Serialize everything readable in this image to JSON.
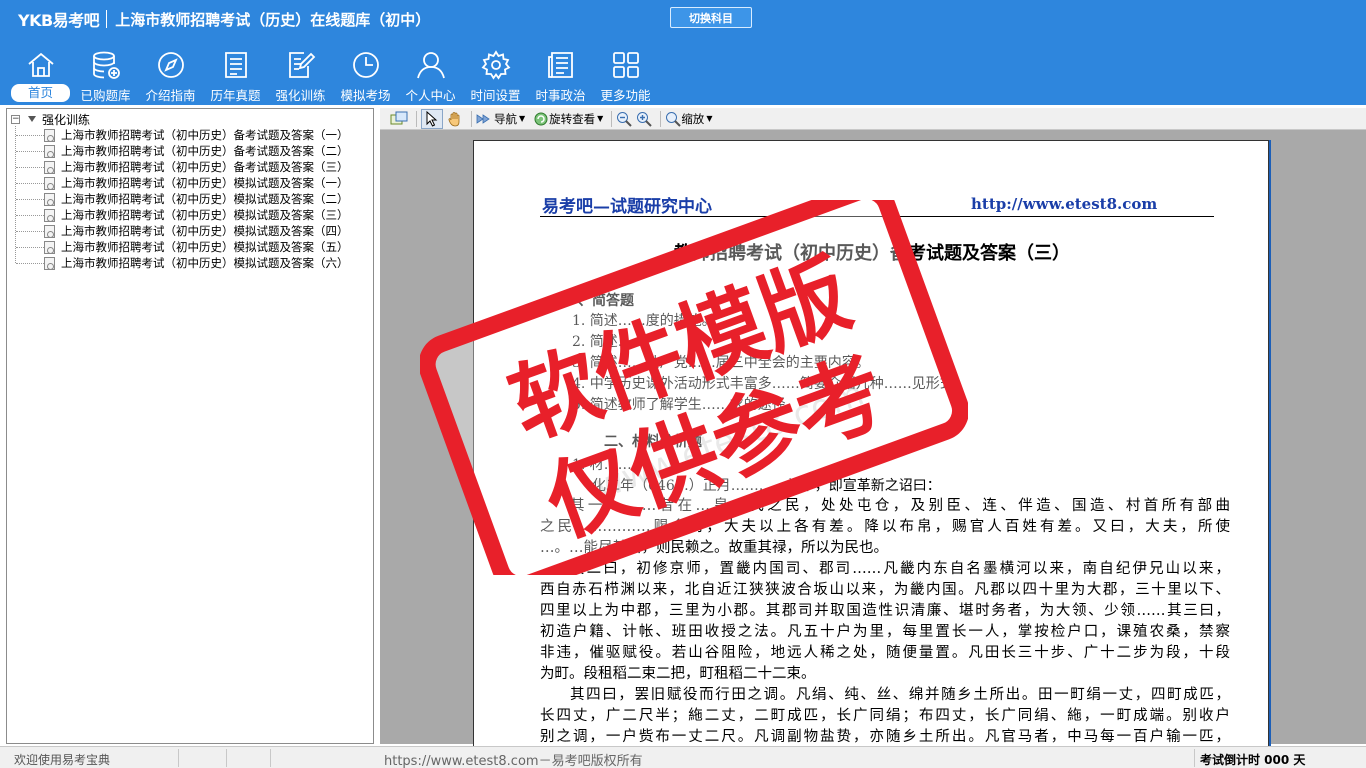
{
  "app": {
    "logo": "YKB易考吧",
    "title": "上海市教师招聘考试（历史）在线题库（初中）",
    "switch_label": "切换科目"
  },
  "nav": [
    {
      "label": "首页",
      "icon": "home-icon"
    },
    {
      "label": "已购题库",
      "icon": "database-icon"
    },
    {
      "label": "介绍指南",
      "icon": "compass-icon"
    },
    {
      "label": "历年真题",
      "icon": "document-list-icon"
    },
    {
      "label": "强化训练",
      "icon": "edit-document-icon"
    },
    {
      "label": "模拟考场",
      "icon": "clock-icon"
    },
    {
      "label": "个人中心",
      "icon": "user-icon"
    },
    {
      "label": "时间设置",
      "icon": "gear-icon"
    },
    {
      "label": "时事政治",
      "icon": "newspaper-icon"
    },
    {
      "label": "更多功能",
      "icon": "grid-icon"
    }
  ],
  "tree": {
    "root": "强化训练",
    "items": [
      "上海市教师招聘考试（初中历史）备考试题及答案（一）",
      "上海市教师招聘考试（初中历史）备考试题及答案（二）",
      "上海市教师招聘考试（初中历史）备考试题及答案（三）",
      "上海市教师招聘考试（初中历史）模拟试题及答案（一）",
      "上海市教师招聘考试（初中历史）模拟试题及答案（二）",
      "上海市教师招聘考试（初中历史）模拟试题及答案（三）",
      "上海市教师招聘考试（初中历史）模拟试题及答案（四）",
      "上海市教师招聘考试（初中历史）模拟试题及答案（五）",
      "上海市教师招聘考试（初中历史）模拟试题及答案（六）"
    ]
  },
  "viewer_toolbar": {
    "nav_label": "导航",
    "rotate_label": "旋转查看",
    "zoom_label": "缩放"
  },
  "document": {
    "header_left": "易考吧—试题研究中心",
    "header_right": "http://www.etest8.com",
    "title": "教师招聘考试（初中历史）备考试题及答案（三）",
    "section1": "一、简答题",
    "q1": "1. 简述……度的措施。",
    "q2": "2. 简述……",
    "q3": "3. 简述……共产党……届三中全会的主要内容。",
    "q4": "4. 中学历史课外活动形式丰富多……简要介绍几种……见形式。",
    "q5": "5. 简述教师了解学生……求的途径。",
    "section2": "二、材料分析题",
    "m1": "1. 材……",
    "p1": "化二年（646…）正月…………礼毕，即宣革新之诏曰：",
    "lines": [
      "其一…，…昔在…皇…代之民，处处屯仓，及别臣、连、伴造、国造、村首所有部曲",
      "之民，…………赐食封，大夫以上各有差。降以布帛，赐官人百姓有差。又曰，大夫，所使",
      "…。…能尽其治，则民赖之。故重其禄，所以为民也。",
      "其二曰，初修京师，置畿内国司、郡司……凡畿内东自名墨横河以来，南自纪伊兄山以来，",
      "西自赤石栉渊以来，北自近江狭狭波合坂山以来，为畿内国。凡郡以四十里为大郡，三十里以下、",
      "四里以上为中郡，三里为小郡。其郡司并取国造性识清廉、堪时务者，为大领、少领……其三曰，",
      "初造户籍、计帐、班田收授之法。凡五十户为里，每里置长一人，掌按检户口，课殖农桑，禁察",
      "非违，催驱赋役。若山谷阻险，地远人稀之处，随便量置。凡田长三十步、广十二步为段，十段",
      "为町。段租稻二束二把，町租稻二十二束。",
      "其四曰，罢旧赋役而行田之调。凡绢、纯、丝、绵并随乡土所出。田一町绢一丈，四町成匹，",
      "长四丈，广二尺半；絁二丈，二町成匹，长广同绢；布四丈，长广同绢、絁，一町成端。别收户",
      "别之调，一户赀布一丈二尺。凡调副物盐贽，亦随乡土所出。凡官马者，中马每一百户输一匹，"
    ]
  },
  "stamp": {
    "line1": "软件模版",
    "line2": "仅供参考",
    "color": "#e8202a"
  },
  "watermark": "www.etest8.com",
  "status": {
    "welcome": "欢迎使用易考宝典",
    "copyright": "https://www.etest8.com－易考吧版权所有",
    "countdown": "考试倒计时 000 天"
  }
}
